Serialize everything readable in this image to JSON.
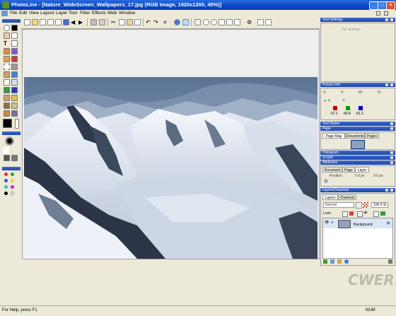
{
  "window": {
    "title": "PhotoLine - [Nature_WideScreen_Wallpapers_17.jpg (RGB Image, 1920x1200, 45%)]"
  },
  "menu": [
    "File",
    "Edit",
    "View",
    "Layout",
    "Layer",
    "Tool",
    "Filter",
    "Effects",
    "Web",
    "Window"
  ],
  "status": {
    "help_text": "For Help, press F1",
    "num": "NUM"
  },
  "panels": {
    "tool_settings": {
      "title": "Tool Settings",
      "body": "No Settings"
    },
    "picture_info": {
      "title": "Picture Info",
      "coord_labels": [
        "X:",
        "Y:",
        "W:",
        "H:"
      ],
      "zero_label": "0",
      "color_values": [
        "67.1",
        "69.8",
        "81.2"
      ]
    },
    "text_styles": {
      "title": "Text Styles"
    },
    "page": {
      "title": "Page",
      "tabs": [
        "Page Map",
        "Documents",
        "Pages"
      ]
    },
    "histogram": {
      "title": "Histogram"
    },
    "scripts": {
      "title": "Scripts"
    },
    "attributes": {
      "title": "Attributes",
      "tabs": [
        "Document",
        "Page",
        "Layer"
      ],
      "fields": [
        {
          "label": "Position",
          "v1": "0.0 px",
          "v2": "0.0 px"
        }
      ]
    },
    "layers": {
      "title": "Layers/Channels",
      "tabs": [
        "Layers",
        "Channels"
      ],
      "mode": "Normal",
      "opacity": "100.0 %",
      "lock_label": "Lock:",
      "layer_name": "Background"
    }
  },
  "colors": {
    "title_blue": "#0a47c4",
    "panel_blue": "#2a55bf",
    "chrome": "#ece9d8"
  },
  "watermark": "CWER.RU"
}
